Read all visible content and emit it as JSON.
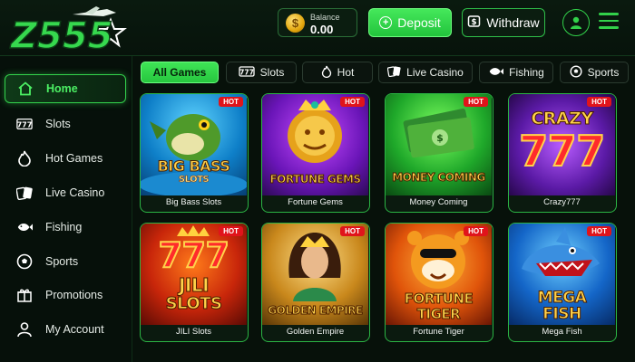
{
  "brand": {
    "logo_text": "Z555"
  },
  "header": {
    "balance_label": "Balance",
    "balance_value": "0.00",
    "deposit_label": "Deposit",
    "withdraw_label": "Withdraw"
  },
  "sidebar": {
    "items": [
      {
        "label": "Home",
        "icon": "home-icon"
      },
      {
        "label": "Slots",
        "icon": "slots-icon"
      },
      {
        "label": "Hot Games",
        "icon": "flame-icon"
      },
      {
        "label": "Live Casino",
        "icon": "cards-icon"
      },
      {
        "label": "Fishing",
        "icon": "fish-icon"
      },
      {
        "label": "Sports",
        "icon": "soccer-ball-icon"
      },
      {
        "label": "Promotions",
        "icon": "gift-icon"
      },
      {
        "label": "My Account",
        "icon": "user-icon"
      }
    ]
  },
  "tabs": [
    {
      "label": "All Games"
    },
    {
      "label": "Slots",
      "icon": "slots-icon"
    },
    {
      "label": "Hot",
      "icon": "flame-icon"
    },
    {
      "label": "Live Casino",
      "icon": "cards-icon"
    },
    {
      "label": "Fishing",
      "icon": "fish-icon"
    },
    {
      "label": "Sports",
      "icon": "soccer-ball-icon"
    }
  ],
  "badge_hot": "HOT",
  "games": [
    {
      "name": "Big Bass Slots",
      "art_lines": [
        "BIG BASS",
        "SLOTS"
      ]
    },
    {
      "name": "Fortune  Gems",
      "art_lines": [
        "FORTUNE GEMS"
      ]
    },
    {
      "name": "Money Coming",
      "art_lines": [
        "MONEY COMING"
      ]
    },
    {
      "name": "Crazy777",
      "art_lines": [
        "CRAZY",
        "777"
      ]
    },
    {
      "name": "JILI Slots",
      "art_lines": [
        "777",
        "JILI",
        "SLOTS"
      ]
    },
    {
      "name": "Golden Empire",
      "art_lines": [
        "GOLDEN EMPIRE"
      ]
    },
    {
      "name": "Fortune Tiger",
      "art_lines": [
        "FORTUNE",
        "TIGER"
      ]
    },
    {
      "name": "Mega Fish",
      "art_lines": [
        "MEGA",
        "FISH"
      ]
    }
  ],
  "colors": {
    "accent": "#33d24c",
    "hot": "#e0141b",
    "bg": "#07110a"
  }
}
